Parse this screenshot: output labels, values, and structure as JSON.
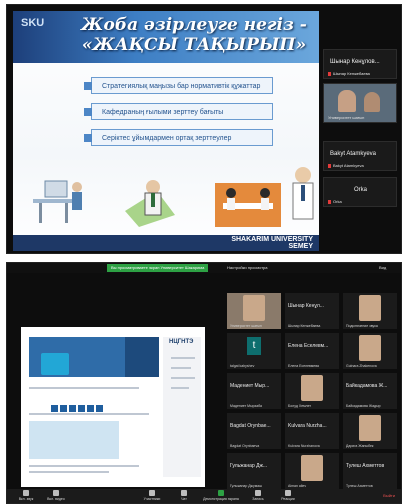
{
  "slide": {
    "title_line1": "Жоба әзірлеуге негіз -",
    "title_line2": "«ЖАҚСЫ ТАҚЫРЫП»",
    "header_small": "SKU",
    "bullets": [
      "Стратегиялық маңызы бар нормативтік құжаттар",
      "Кафедраның ғылыми зерттеу бағыты",
      "Серіктес ұйымдармен ортақ зерттеулер"
    ],
    "footer_line1": "SHAKARIM UNIVERSITY",
    "footer_line2": "SEMEY"
  },
  "top_participants": [
    {
      "name": "Шынар Кенұлов...",
      "sub": "Шынар Кенжебаева"
    },
    {
      "name": "",
      "sub": "Университет шағын"
    },
    {
      "name": "Bakyt Atamkyeva",
      "sub": "Bakyt Atamkyeva"
    },
    {
      "name": "Orka",
      "sub": "Orka"
    }
  ],
  "zoom": {
    "recording_banner": "Вы просматриваете экран Университет Шакарима",
    "view_options": "Настройки просмотра",
    "view_label": "Вид",
    "shared_title": "НЦГНТЭ",
    "participants": [
      {
        "name": "",
        "sub": "Университет шағын"
      },
      {
        "name": "Шынар Кенұл...",
        "sub": "Шынар Кенжебаева"
      },
      {
        "name": "",
        "sub": "Подключение звука"
      },
      {
        "name": "t",
        "sub": "talgat kabyshev"
      },
      {
        "name": "Елена Еселевм...",
        "sub": "Елена Еселевмева"
      },
      {
        "name": "",
        "sub": "Gulnara Zhakenova"
      },
      {
        "name": "Мадениет Мыр...",
        "sub": "Мадениет Мырзаба"
      },
      {
        "name": "",
        "sub": "Болуд Хемлет"
      },
      {
        "name": "Байкадамова Ж...",
        "sub": "Байкадамова Жадыр"
      },
      {
        "name": "Bagdat Orynbae...",
        "sub": "Bagdat Orynbaeva"
      },
      {
        "name": "Kulvara Nurzha...",
        "sub": "Kulvara Nurzhanova"
      },
      {
        "name": "",
        "sub": "Дарига Жаныбек"
      },
      {
        "name": "Гульжанар Дж...",
        "sub": "Гульжанар Джумаш"
      },
      {
        "name": "",
        "sub": "Aiman aliev"
      },
      {
        "name": "Тулеш Ахметтов",
        "sub": "Тулеш Ахметтов"
      },
      {
        "name": "",
        "sub": "Гульнур Бейсенбаева"
      },
      {
        "name": "",
        "sub": "Эльмира Темирбаева"
      },
      {
        "name": "",
        "sub": "Галия Турлыбаева"
      }
    ],
    "toolbar": [
      {
        "label": "Вкл. звук",
        "green": false
      },
      {
        "label": "Вкл. видео",
        "green": false
      },
      {
        "label": "Участники",
        "green": false
      },
      {
        "label": "Чат",
        "green": false
      },
      {
        "label": "Демонстрация экрана",
        "green": true
      },
      {
        "label": "Запись",
        "green": false
      },
      {
        "label": "Реакции",
        "green": false
      }
    ],
    "exit": "Выйти"
  }
}
